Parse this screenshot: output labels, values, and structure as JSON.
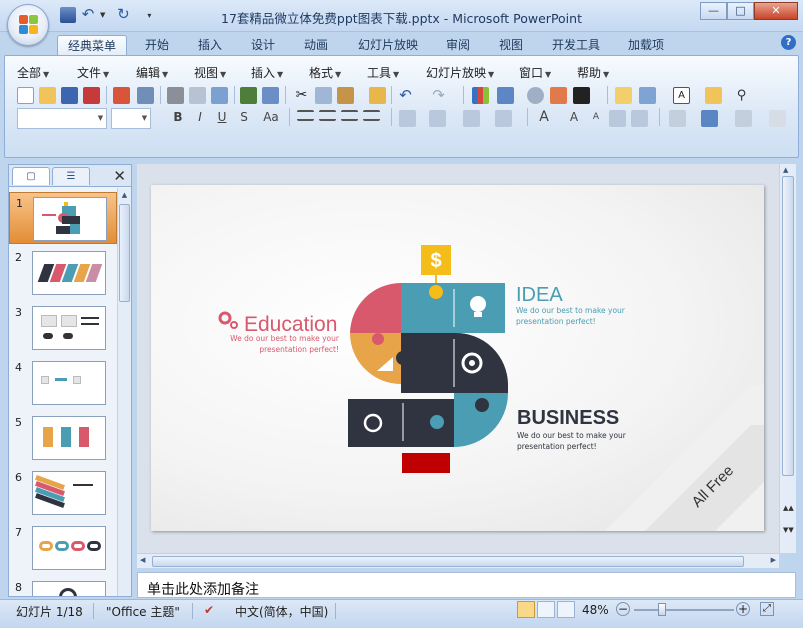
{
  "window": {
    "title": "17套精品微立体免费ppt图表下载.pptx - Microsoft PowerPoint",
    "controls": {
      "minimize": "—",
      "maximize": "□",
      "close": "✕"
    }
  },
  "ribbon_tabs": [
    "经典菜单",
    "开始",
    "插入",
    "设计",
    "动画",
    "幻灯片放映",
    "审阅",
    "视图",
    "开发工具",
    "加载项"
  ],
  "menu_bar": [
    "全部",
    "文件",
    "编辑",
    "视图",
    "插入",
    "格式",
    "工具",
    "幻灯片放映",
    "窗口",
    "帮助"
  ],
  "format_buttons": {
    "bold": "B",
    "italic": "I",
    "underline": "U",
    "strike": "S",
    "case": "Aa",
    "font_size_up": "A",
    "font_size_down": "A"
  },
  "outline_pane": {
    "tab_close": "✕",
    "slide_numbers": [
      "1",
      "2",
      "3",
      "4",
      "5",
      "6",
      "7",
      "8"
    ],
    "selected_slide": "1"
  },
  "slide": {
    "education_title": "Education",
    "education_desc": "We do our best to make your presentation perfect!",
    "idea_title": "IDEA",
    "idea_desc": "We do our best to make your presentation perfect!",
    "business_title": "BUSINESS",
    "business_desc": "We do our best to make your presentation perfect!",
    "corner_label": "All Free",
    "dollar_sign": "$",
    "colors": {
      "education": "#d9596c",
      "idea": "#4a9db3",
      "business": "#2f3440",
      "orange": "#e8a448",
      "yellow": "#f5bd1a",
      "red": "#c00000"
    }
  },
  "notes": {
    "placeholder": "单击此处添加备注"
  },
  "status_bar": {
    "slide_position": "幻灯片 1/18",
    "theme": "\"Office 主题\"",
    "language": "中文(简体，中国)",
    "zoom": "48%",
    "zoom_level": 0.48
  }
}
